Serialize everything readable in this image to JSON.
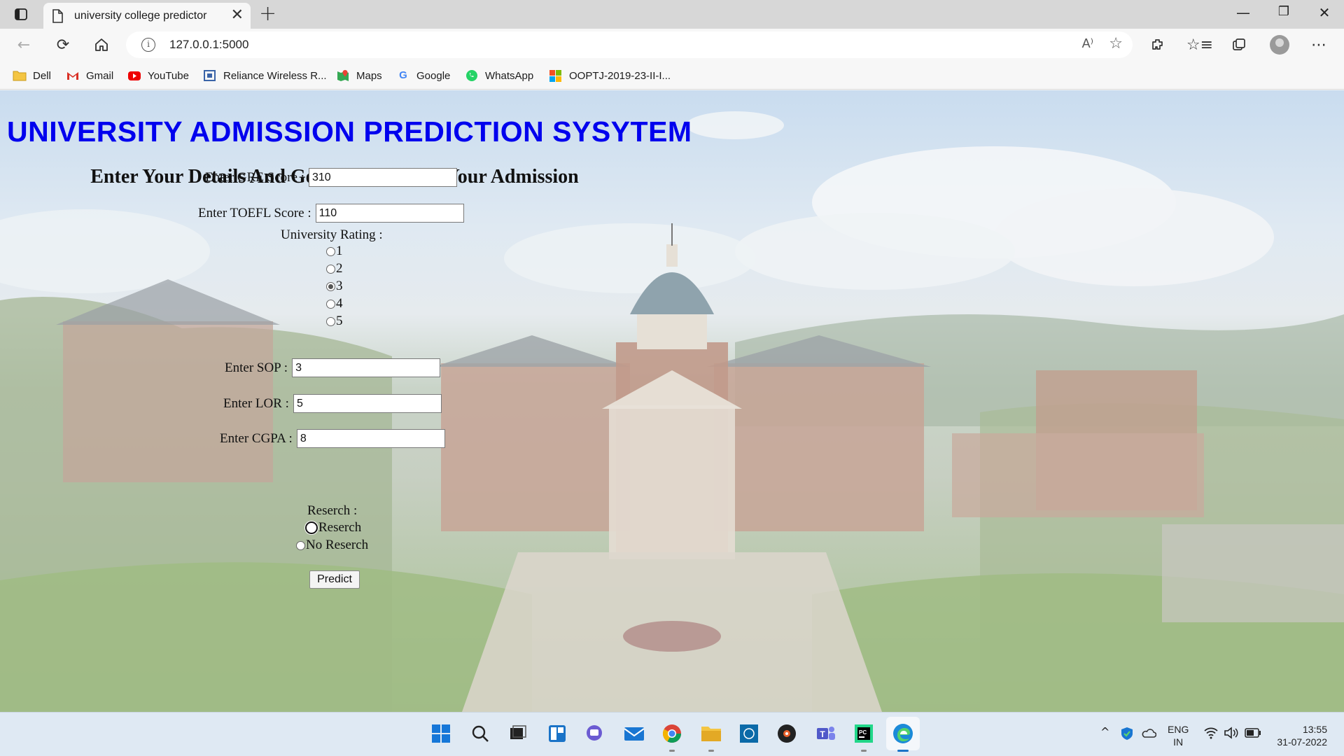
{
  "browser": {
    "tab_title": "university college predictor",
    "url": "127.0.0.1:5000",
    "read_aloud": "A⁾",
    "bookmarks": [
      {
        "label": "Dell",
        "icon": "folder-icon"
      },
      {
        "label": "Gmail",
        "icon": "gmail-icon"
      },
      {
        "label": "YouTube",
        "icon": "youtube-icon"
      },
      {
        "label": "Reliance Wireless R...",
        "icon": "page-icon"
      },
      {
        "label": "Maps",
        "icon": "maps-icon"
      },
      {
        "label": "Google",
        "icon": "google-icon"
      },
      {
        "label": "WhatsApp",
        "icon": "whatsapp-icon"
      },
      {
        "label": "OOPTJ-2019-23-II-I...",
        "icon": "microsoft-icon"
      }
    ]
  },
  "page": {
    "title": "UNIVERSITY ADMISSION PREDICTION SYSYTEM",
    "subtitle": "Enter Your Details And Get Probablity Of Your Admission",
    "gre_label": "Enter GRE Score :",
    "gre_value": "310",
    "toefl_label": "Enter TOEFL Score :",
    "toefl_value": "110",
    "rating_label": "University Rating :",
    "rating_options": [
      "1",
      "2",
      "3",
      "4",
      "5"
    ],
    "rating_selected": "3",
    "sop_label": "Enter SOP :",
    "sop_value": "3",
    "lor_label": "Enter LOR :",
    "lor_value": "5",
    "cgpa_label": "Enter CGPA :",
    "cgpa_value": "8",
    "research_label": "Reserch :",
    "research_options": [
      "Reserch",
      "No Reserch"
    ],
    "predict_label": "Predict"
  },
  "taskbar": {
    "lang_top": "ENG",
    "lang_bottom": "IN",
    "time": "13:55",
    "date": "31-07-2022"
  }
}
